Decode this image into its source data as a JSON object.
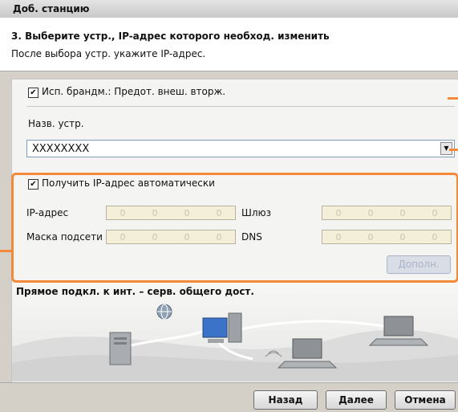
{
  "window": {
    "title": "Доб. станцию"
  },
  "header": {
    "step_title": "3. Выберите устр., IP-адрес которого необход. изменить",
    "instruction": "После выбора устр. укажите IP-адрес."
  },
  "firewall": {
    "label": "Исп. брандм.: Предот. внеш. вторж.",
    "checked": true,
    "check_glyph": "✔"
  },
  "device": {
    "name_label": "Назв. устр.",
    "selected": "XXXXXXXX",
    "dropdown_glyph": "▼"
  },
  "ip_settings": {
    "auto_label": "Получить IP-адрес автоматически",
    "auto_checked": true,
    "auto_check_glyph": "✔",
    "ip_label": "IP-адрес",
    "mask_label": "Маска подсети",
    "gateway_label": "Шлюз",
    "dns_label": "DNS",
    "ip_value": [
      "0",
      "0",
      "0",
      "0"
    ],
    "mask_value": [
      "0",
      "0",
      "0",
      "0"
    ],
    "gateway_value": [
      "0",
      "0",
      "0",
      "0"
    ],
    "dns_value": [
      "0",
      "0",
      "0",
      "0"
    ],
    "add_button": "Дополн."
  },
  "diagram": {
    "caption": "Прямое подкл. к инт. – серв. общего дост."
  },
  "footer": {
    "back": "Назад",
    "next": "Далее",
    "cancel": "Отмена"
  },
  "colors": {
    "highlight": "#f28a3a",
    "accent": "#7f9db9"
  }
}
